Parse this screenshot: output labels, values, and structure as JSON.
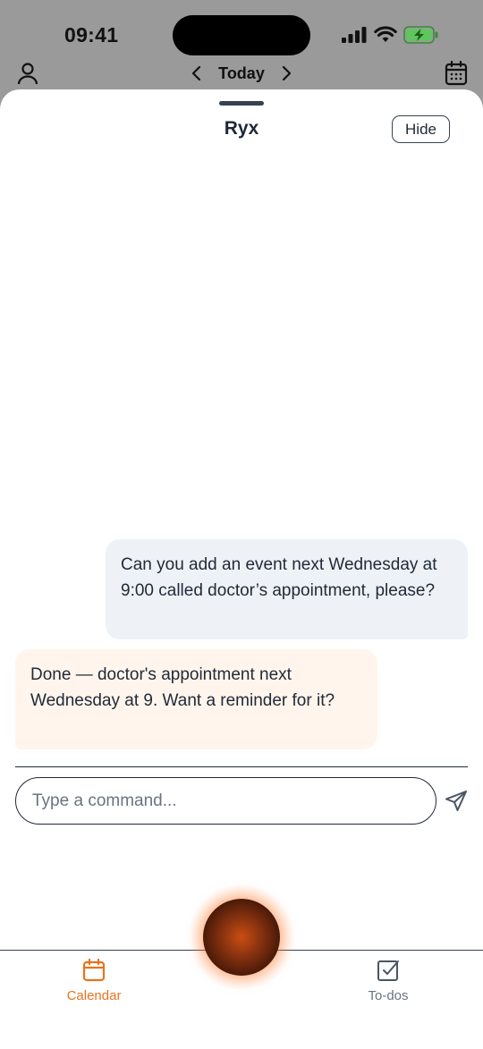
{
  "status_bar": {
    "time": "09:41"
  },
  "top_nav": {
    "title": "Today"
  },
  "sheet": {
    "title": "Ryx",
    "hide_label": "Hide"
  },
  "messages": [
    {
      "role": "user",
      "text": "Can you add an event next Wednesday at 9:00 called doctor’s appointment, please?"
    },
    {
      "role": "assistant",
      "text": "Done — doctor's appointment next Wednesday at 9. Want a reminder for it?"
    }
  ],
  "composer": {
    "placeholder": "Type a command...",
    "value": ""
  },
  "tabs": [
    {
      "label": "Calendar",
      "active": true,
      "icon": "calendar-icon"
    },
    {
      "label": "To-dos",
      "active": false,
      "icon": "checkbox-icon"
    }
  ],
  "colors": {
    "accent": "#e8731f",
    "text": "#1f2937",
    "user_bubble": "#eef2f7",
    "bot_bubble": "#fff5ec"
  }
}
